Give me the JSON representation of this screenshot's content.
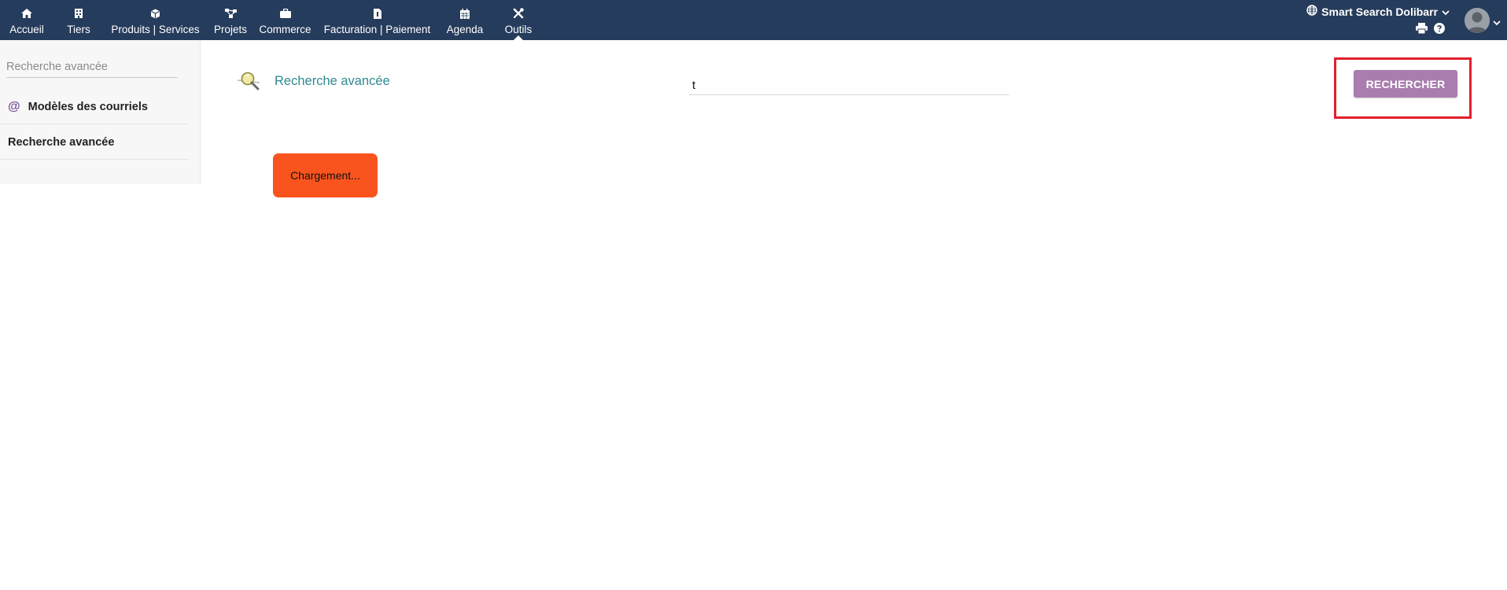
{
  "nav": {
    "items": [
      {
        "label": "Accueil",
        "icon": "home-icon"
      },
      {
        "label": "Tiers",
        "icon": "building-icon"
      },
      {
        "label": "Produits | Services",
        "icon": "cube-icon"
      },
      {
        "label": "Projets",
        "icon": "project-icon"
      },
      {
        "label": "Commerce",
        "icon": "briefcase-icon"
      },
      {
        "label": "Facturation | Paiement",
        "icon": "invoice-icon"
      },
      {
        "label": "Agenda",
        "icon": "calendar-icon"
      },
      {
        "label": "Outils",
        "icon": "tools-icon",
        "active": true
      }
    ]
  },
  "header": {
    "company": "Smart Search Dolibarr"
  },
  "sidebar": {
    "search_placeholder": "Recherche avancée",
    "items": [
      {
        "label": "Modèles des courriels",
        "icon": "at-icon"
      },
      {
        "label": "Recherche avancée"
      }
    ]
  },
  "main": {
    "title": "Recherche avancée",
    "search_value": "t",
    "search_button": "RECHERCHER",
    "loading_text": "Chargement..."
  },
  "colors": {
    "topbar": "#263c5c",
    "accent_button": "#a97dae",
    "loading": "#fa541e",
    "title": "#2f8a8f",
    "highlight": "#e21f2c"
  }
}
